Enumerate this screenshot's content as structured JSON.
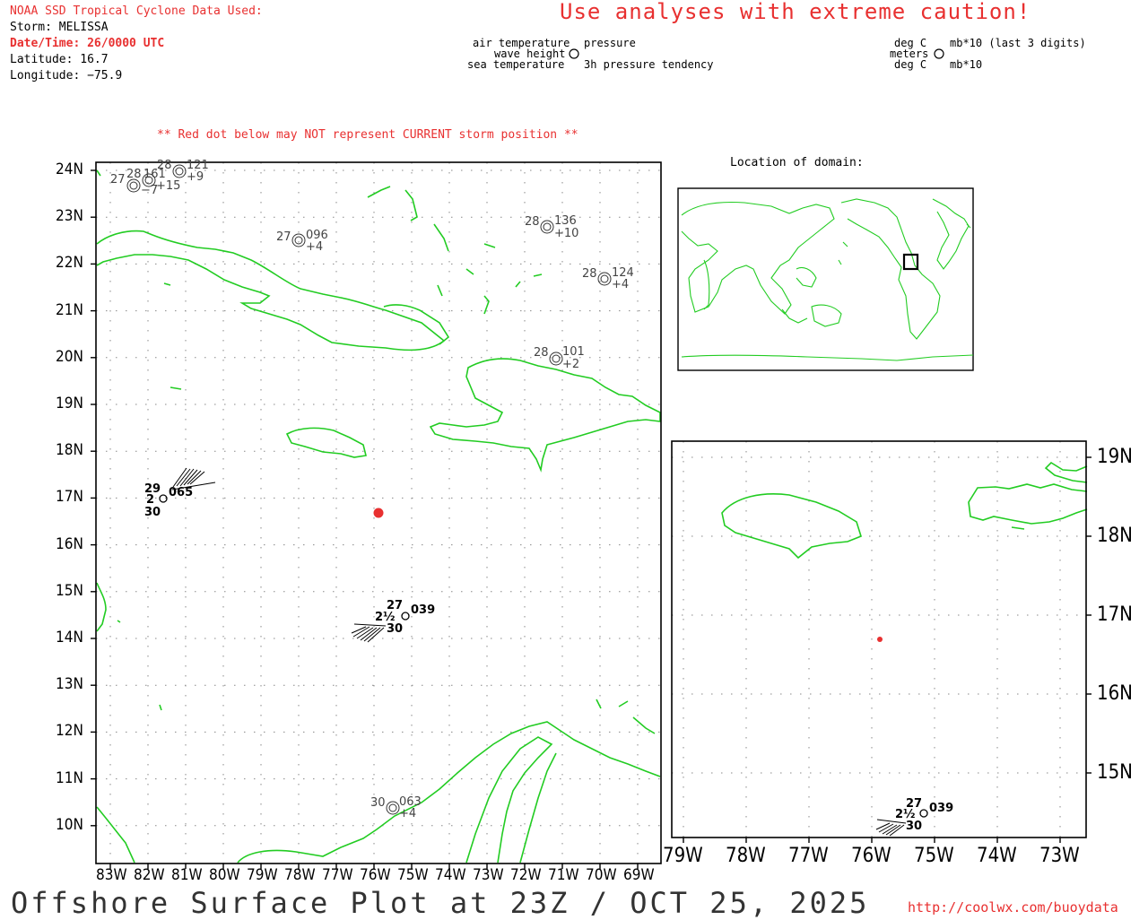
{
  "header": {
    "data_used": "NOAA SSD Tropical Cyclone Data Used:",
    "storm": "Storm: MELISSA",
    "datetime": "Date/Time: 26/0000 UTC",
    "latitude": "Latitude: 16.7",
    "longitude": "Longitude: −75.9",
    "caution": "Use analyses with extreme caution!"
  },
  "legend": {
    "air_temperature": "air temperature",
    "wave_height": "wave height",
    "sea_temperature": "sea temperature",
    "pressure": "pressure",
    "pressure_tendency": "3h pressure tendency",
    "deg_c_top": "deg C",
    "meters": "meters",
    "deg_c_bottom": "deg C",
    "mb_top": "mb*10 (last 3 digits)",
    "mb_bottom": "mb*10"
  },
  "warning": "** Red dot below may NOT represent CURRENT storm position **",
  "location_label": "Location of domain:",
  "main_map": {
    "lat_labels": [
      "24N",
      "23N",
      "22N",
      "21N",
      "20N",
      "19N",
      "18N",
      "17N",
      "16N",
      "15N",
      "14N",
      "13N",
      "12N",
      "11N",
      "10N"
    ],
    "lon_labels": [
      "83W",
      "82W",
      "81W",
      "80W",
      "79W",
      "78W",
      "77W",
      "76W",
      "75W",
      "74W",
      "73W",
      "72W",
      "71W",
      "70W",
      "69W"
    ]
  },
  "zoom_map": {
    "lat_labels": [
      "19N",
      "18N",
      "17N",
      "16N",
      "15N"
    ],
    "lon_labels": [
      "79W",
      "78W",
      "77W",
      "76W",
      "75W",
      "74W",
      "73W"
    ]
  },
  "storm_position": {
    "lat": 16.7,
    "lon": -75.9,
    "color": "#e83030"
  },
  "stations": [
    {
      "air": "27",
      "pressure": "096",
      "tendency": "+4"
    },
    {
      "air": "28",
      "pressure": "136",
      "tendency": "+10"
    },
    {
      "air": "28",
      "pressure": "124",
      "tendency": "+4"
    },
    {
      "air": "28",
      "pressure": "101",
      "tendency": "+2"
    },
    {
      "air": "30",
      "pressure": "063",
      "tendency": "+4"
    },
    {
      "air": "27",
      "pressure": "",
      "tendency": "−7"
    },
    {
      "air": "28",
      "pressure": "161",
      "tendency": "+15"
    },
    {
      "air": "28",
      "pressure": "121",
      "tendency": "+9"
    }
  ],
  "ships": [
    {
      "air": "29",
      "wave": "2",
      "sea": "30",
      "pressure": "065"
    },
    {
      "air": "27",
      "wave": "2½",
      "sea": "30",
      "pressure": "039"
    }
  ],
  "footer": {
    "title": "Offshore Surface Plot at 23Z / OCT 25, 2025",
    "url": "http://coolwx.com/buoydata"
  },
  "colors": {
    "coast": "#22cc22",
    "accent_red": "#e83030",
    "frame": "#000000",
    "grid": "#888888"
  }
}
